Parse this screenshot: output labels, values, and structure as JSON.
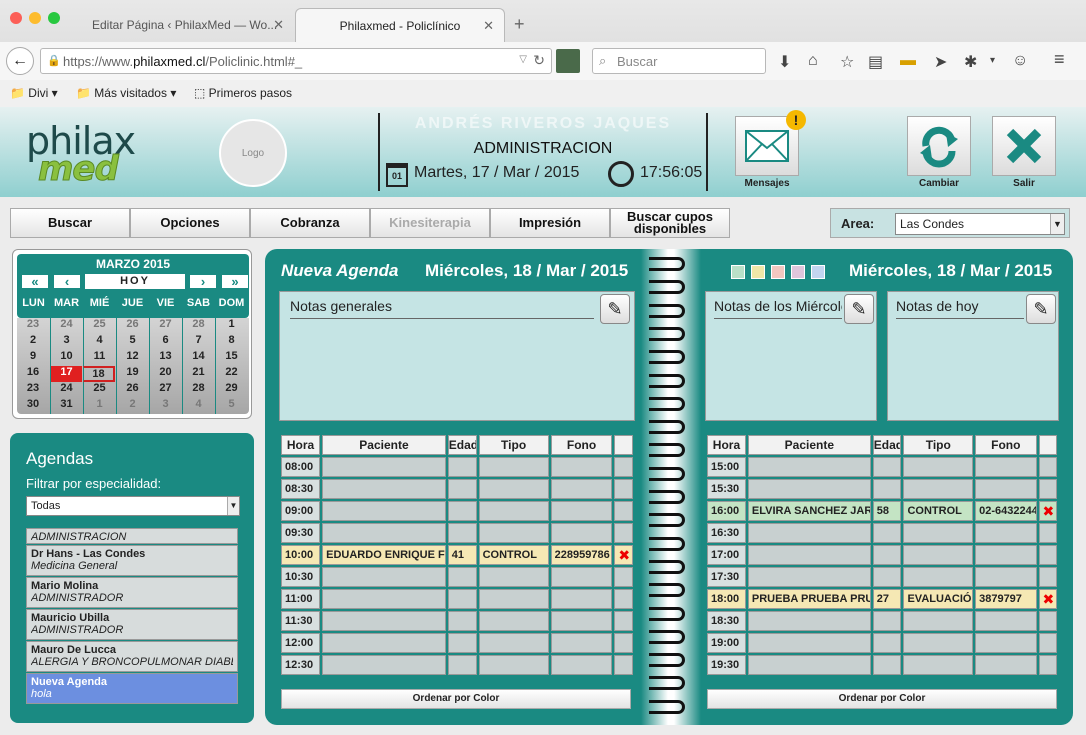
{
  "browser": {
    "tabs": [
      {
        "label": "Editar Página ‹ PhilaxMed — Wo..."
      },
      {
        "label": "Philaxmed - Policlínico"
      }
    ],
    "url_prefix": "https://www.",
    "url_domain": "philaxmed.cl",
    "url_path": "/Policlinic.html#_",
    "search_placeholder": "Buscar",
    "bookmarks": [
      "Divi",
      "Más visitados",
      "Primeros pasos"
    ]
  },
  "header": {
    "logo_top": "philax",
    "logo_bottom": "med",
    "logo_placeholder": "Logo",
    "ghost_name": "ANDRÉS RIVEROS JAQUES",
    "role": "ADMINISTRACION",
    "date": "Martes, 17 / Mar / 2015",
    "calendar_icon_day": "01",
    "time": "17:56:05",
    "badge": "!",
    "btn_messages": "Mensajes",
    "btn_change": "Cambiar",
    "btn_exit": "Salir"
  },
  "menu": {
    "items": [
      "Buscar",
      "Opciones",
      "Cobranza",
      "Kinesiterapia",
      "Impresión",
      "Buscar cupos disponibles"
    ],
    "area_label": "Area:",
    "area_value": "Las Condes"
  },
  "calendar": {
    "month": "MARZO 2015",
    "today": "HOY",
    "nav": [
      "«",
      "‹",
      "›",
      "»"
    ],
    "weekdays": [
      "LUN",
      "MAR",
      "MIÉ",
      "JUE",
      "VIE",
      "SAB",
      "DOM"
    ],
    "days": [
      [
        "23",
        "24",
        "25",
        "26",
        "27",
        "28",
        "1"
      ],
      [
        "2",
        "3",
        "4",
        "5",
        "6",
        "7",
        "8"
      ],
      [
        "9",
        "10",
        "11",
        "12",
        "13",
        "14",
        "15"
      ],
      [
        "16",
        "17",
        "18",
        "19",
        "20",
        "21",
        "22"
      ],
      [
        "23",
        "24",
        "25",
        "26",
        "27",
        "28",
        "29"
      ],
      [
        "30",
        "31",
        "1",
        "2",
        "3",
        "4",
        "5"
      ]
    ],
    "selected": "17",
    "marked": "18"
  },
  "agendas": {
    "title": "Agendas",
    "filter_label": "Filtrar por especialidad:",
    "filter_value": "Todas",
    "items": [
      {
        "name": "",
        "sub": "ADMINISTRACION"
      },
      {
        "name": "Dr Hans - Las Condes",
        "sub": "Medicina General"
      },
      {
        "name": "Mario Molina",
        "sub": "ADMINISTRADOR"
      },
      {
        "name": "Mauricio Ubilla",
        "sub": "ADMINISTRADOR"
      },
      {
        "name": "Mauro De Lucca",
        "sub": "ALERGIA Y BRONCOPULMONAR DIABE"
      },
      {
        "name": "Nueva Agenda",
        "sub": "hola"
      }
    ]
  },
  "book": {
    "left": {
      "agenda_name": "Nueva Agenda",
      "date": "Miércoles, 18 / Mar / 2015",
      "notes_title": "Notas generales",
      "columns": [
        "Hora",
        "Paciente",
        "Edad",
        "Tipo",
        "Fono",
        ""
      ],
      "rows": [
        {
          "hora": "08:00",
          "paciente": "",
          "edad": "",
          "tipo": "",
          "fono": "",
          "x": ""
        },
        {
          "hora": "08:30",
          "paciente": "",
          "edad": "",
          "tipo": "",
          "fono": "",
          "x": ""
        },
        {
          "hora": "09:00",
          "paciente": "",
          "edad": "",
          "tipo": "",
          "fono": "",
          "x": ""
        },
        {
          "hora": "09:30",
          "paciente": "",
          "edad": "",
          "tipo": "",
          "fono": "",
          "x": ""
        },
        {
          "hora": "10:00",
          "paciente": "EDUARDO ENRIQUE F",
          "edad": "41",
          "tipo": "CONTROL",
          "fono": "228959786",
          "x": "✖",
          "color": "yel"
        },
        {
          "hora": "10:30",
          "paciente": "",
          "edad": "",
          "tipo": "",
          "fono": "",
          "x": ""
        },
        {
          "hora": "11:00",
          "paciente": "",
          "edad": "",
          "tipo": "",
          "fono": "",
          "x": ""
        },
        {
          "hora": "11:30",
          "paciente": "",
          "edad": "",
          "tipo": "",
          "fono": "",
          "x": ""
        },
        {
          "hora": "12:00",
          "paciente": "",
          "edad": "",
          "tipo": "",
          "fono": "",
          "x": ""
        },
        {
          "hora": "12:30",
          "paciente": "",
          "edad": "",
          "tipo": "",
          "fono": "",
          "x": ""
        }
      ],
      "order_label": "Ordenar por Color"
    },
    "right": {
      "date": "Miércoles, 18 / Mar / 2015",
      "swatches": [
        "#b9e0c8",
        "#f0e7a8",
        "#f2c7c0",
        "#dfc6dc",
        "#c3d5f0"
      ],
      "notes_day_title": "Notas de los Miércoles",
      "notes_today_title": "Notas de hoy",
      "columns": [
        "Hora",
        "Paciente",
        "Edad",
        "Tipo",
        "Fono",
        ""
      ],
      "rows": [
        {
          "hora": "15:00",
          "paciente": "",
          "edad": "",
          "tipo": "",
          "fono": "",
          "x": ""
        },
        {
          "hora": "15:30",
          "paciente": "",
          "edad": "",
          "tipo": "",
          "fono": "",
          "x": ""
        },
        {
          "hora": "16:00",
          "paciente": "ELVIRA SANCHEZ JAR",
          "edad": "58",
          "tipo": "CONTROL",
          "fono": "02-6432244",
          "x": "✖",
          "color": "grn"
        },
        {
          "hora": "16:30",
          "paciente": "",
          "edad": "",
          "tipo": "",
          "fono": "",
          "x": ""
        },
        {
          "hora": "17:00",
          "paciente": "",
          "edad": "",
          "tipo": "",
          "fono": "",
          "x": ""
        },
        {
          "hora": "17:30",
          "paciente": "",
          "edad": "",
          "tipo": "",
          "fono": "",
          "x": ""
        },
        {
          "hora": "18:00",
          "paciente": "PRUEBA PRUEBA PRU",
          "edad": "27",
          "tipo": "EVALUACIÓN",
          "fono": "3879797",
          "x": "✖",
          "color": "yel"
        },
        {
          "hora": "18:30",
          "paciente": "",
          "edad": "",
          "tipo": "",
          "fono": "",
          "x": ""
        },
        {
          "hora": "19:00",
          "paciente": "",
          "edad": "",
          "tipo": "",
          "fono": "",
          "x": ""
        },
        {
          "hora": "19:30",
          "paciente": "",
          "edad": "",
          "tipo": "",
          "fono": "",
          "x": ""
        }
      ],
      "order_label": "Ordenar por Color"
    }
  }
}
